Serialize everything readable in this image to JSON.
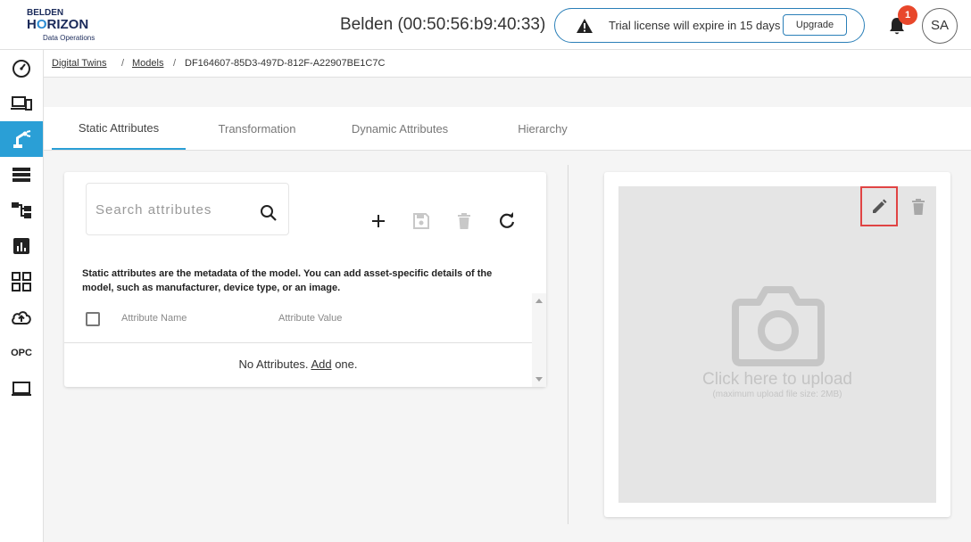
{
  "header": {
    "logo_line1": "BELDEN",
    "logo_line2_a": "H",
    "logo_line2_o": "O",
    "logo_line2_b": "RIZON",
    "logo_line3": "Data Operations",
    "device_title": "Belden (00:50:56:b9:40:33)",
    "trial_message": "Trial license will expire in 15 days",
    "upgrade_label": "Upgrade",
    "notification_count": "1",
    "avatar_initials": "SA"
  },
  "sidebar": {
    "items": [
      {
        "icon": "dashboard-gauge-icon"
      },
      {
        "icon": "devices-icon"
      },
      {
        "icon": "robot-arm-icon",
        "active": true
      },
      {
        "icon": "list-icon"
      },
      {
        "icon": "hierarchy-icon"
      },
      {
        "icon": "analytics-icon"
      },
      {
        "icon": "apps-grid-icon"
      },
      {
        "icon": "cloud-upload-icon"
      },
      {
        "icon": "opc-icon",
        "label": "OPC"
      },
      {
        "icon": "laptop-icon"
      }
    ],
    "active_color": "#2a9fd6"
  },
  "breadcrumb": {
    "items": [
      "Digital Twins",
      "Models",
      "DF164607-85D3-497D-812F-A22907BE1C7C"
    ],
    "separator": "/"
  },
  "tabs": [
    {
      "label": "Static Attributes",
      "active": true
    },
    {
      "label": "Transformation"
    },
    {
      "label": "Dynamic Attributes"
    },
    {
      "label": "Hierarchy"
    }
  ],
  "attributes": {
    "search_placeholder": "Search attributes",
    "toolbar": [
      "add-icon",
      "save-icon",
      "delete-icon",
      "refresh-icon"
    ],
    "description": "Static attributes are the metadata of the model. You can add asset-specific details of the model, such as manufacturer, device type, or an image.",
    "columns": [
      "Attribute Name",
      "Attribute Value"
    ],
    "empty_prefix": "No Attributes. ",
    "empty_link": "Add",
    "empty_suffix": " one."
  },
  "image_panel": {
    "upload_text": "Click here to upload",
    "upload_sub": "(maximum upload file size: 2MB)",
    "highlight_color": "#e04444"
  }
}
